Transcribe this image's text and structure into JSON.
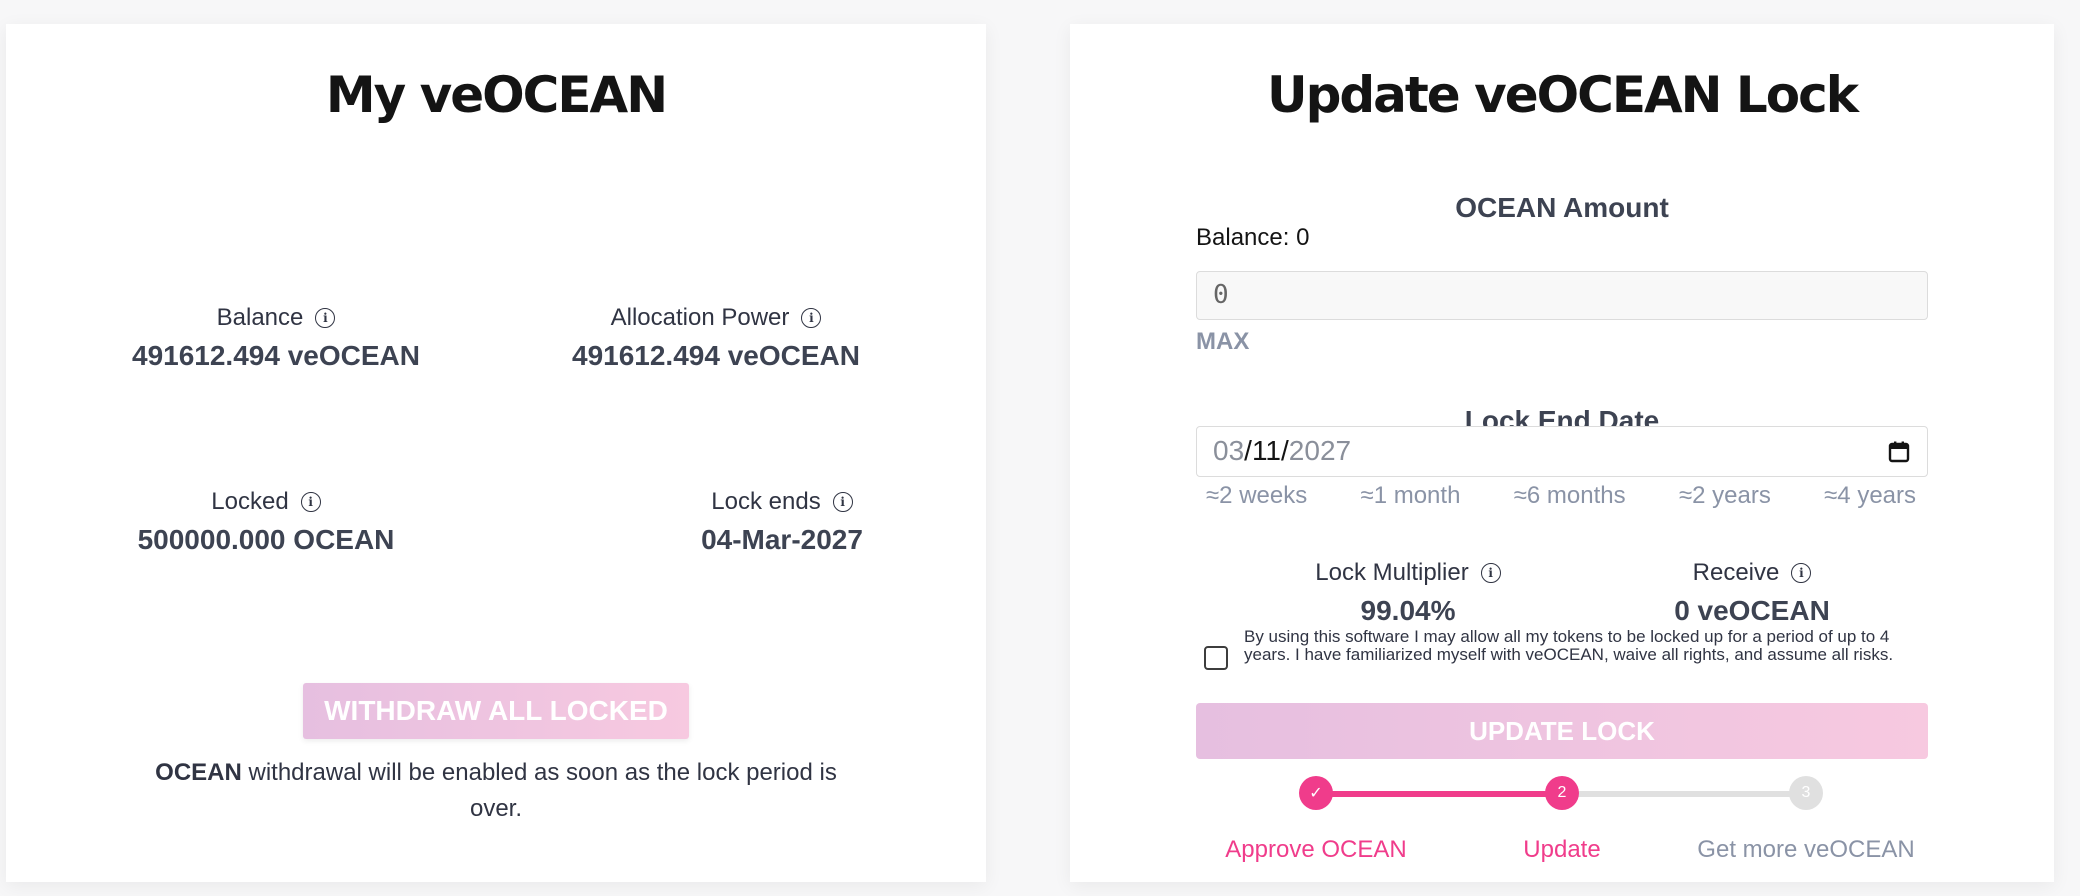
{
  "left_card": {
    "title": "My veOCEAN",
    "stats": {
      "balance": {
        "label": "Balance",
        "value": "491612.494 veOCEAN"
      },
      "allocation_power": {
        "label": "Allocation Power",
        "value": "491612.494 veOCEAN"
      },
      "locked": {
        "label": "Locked",
        "value": "500000.000 OCEAN"
      },
      "lock_ends": {
        "label": "Lock ends",
        "value": "04-Mar-2027"
      }
    },
    "withdraw_button": "WITHDRAW ALL LOCKED",
    "withdraw_note_bold": "OCEAN",
    "withdraw_note_text": " withdrawal will be enabled as soon as the lock period is over."
  },
  "right_card": {
    "title": "Update veOCEAN Lock",
    "amount_section_title": "OCEAN Amount",
    "balance_text": "Balance: 0",
    "amount_value": "0",
    "max_label": "MAX",
    "lock_end_title": "Lock End Date",
    "date": {
      "month": "03",
      "sep1": "/",
      "day": "11",
      "sep2": "/",
      "year": "2027"
    },
    "presets": [
      "≈2 weeks",
      "≈1 month",
      "≈6 months",
      "≈2 years",
      "≈4 years"
    ],
    "lock_multiplier": {
      "label": "Lock Multiplier",
      "value": "99.04%"
    },
    "receive": {
      "label": "Receive",
      "value": "0 veOCEAN"
    },
    "terms_text": "By using this software I may allow all my tokens to be locked up for a period of up to 4 years. I have familiarized myself with veOCEAN, waive all rights, and assume all risks.",
    "update_button": "UPDATE LOCK",
    "steps": [
      {
        "label": "Approve OCEAN",
        "marker": "✓",
        "state": "done"
      },
      {
        "label": "Update",
        "marker": "2",
        "state": "active"
      },
      {
        "label": "Get more veOCEAN",
        "marker": "3",
        "state": "pending"
      }
    ]
  },
  "colors": {
    "accent_pink": "#f03c8b",
    "disabled_button_start": "#e6bfe0",
    "disabled_button_end": "#f7c9e0",
    "muted_text": "#8a93a6",
    "pending_gray": "#e0e0e0"
  }
}
